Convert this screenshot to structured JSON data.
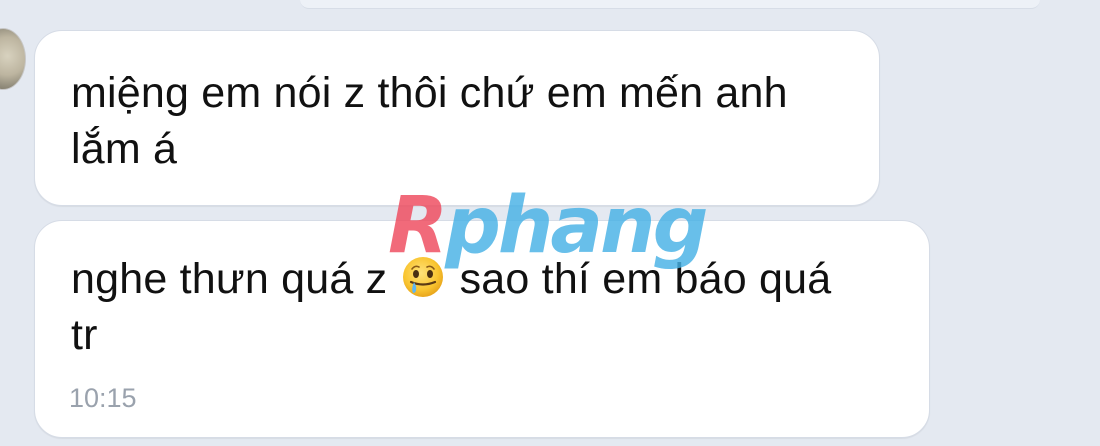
{
  "messages": [
    {
      "lines": [
        "miệng em nói z thôi chứ em mến anh",
        "lắm á"
      ]
    },
    {
      "line1_before_emoji": "nghe thưn quá z ",
      "emoji": "face-holding-back-tears-icon",
      "line1_after_emoji": " sao thí em báo quá",
      "line2": "tr",
      "time": "10:15"
    }
  ],
  "watermark": {
    "first_letter": "R",
    "rest": "phang"
  },
  "colors": {
    "background": "#e4e9f1",
    "bubble": "#ffffff",
    "text": "#111111",
    "timestamp": "#9aa2ad",
    "watermark_red": "#ef4a5d",
    "watermark_blue": "#47b2e6"
  }
}
